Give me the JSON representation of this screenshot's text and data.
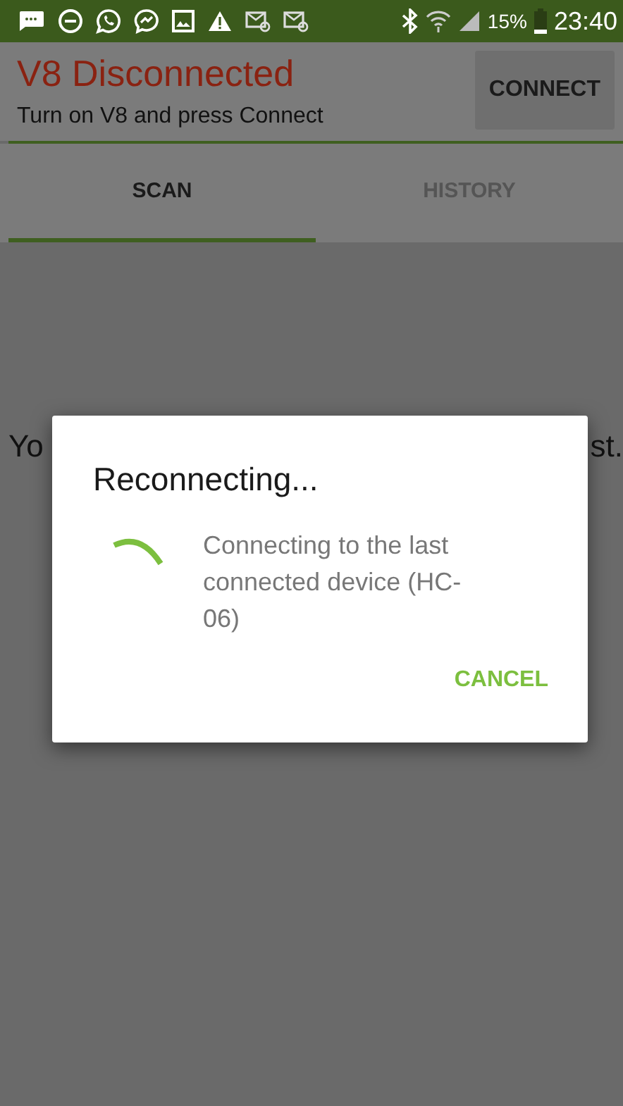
{
  "status_bar": {
    "battery": "15%",
    "time": "23:40"
  },
  "header": {
    "title": "V8 Disconnected",
    "subtitle": "Turn on V8 and press Connect",
    "connect_button": "CONNECT"
  },
  "tabs": [
    {
      "label": "SCAN",
      "selected": true
    },
    {
      "label": "HISTORY",
      "selected": false
    }
  ],
  "background_text": {
    "left": "Yo",
    "right": "st."
  },
  "dialog": {
    "title": "Reconnecting...",
    "message": "Connecting to the last connected device (HC-06)",
    "buttons": [
      "CANCEL"
    ]
  }
}
